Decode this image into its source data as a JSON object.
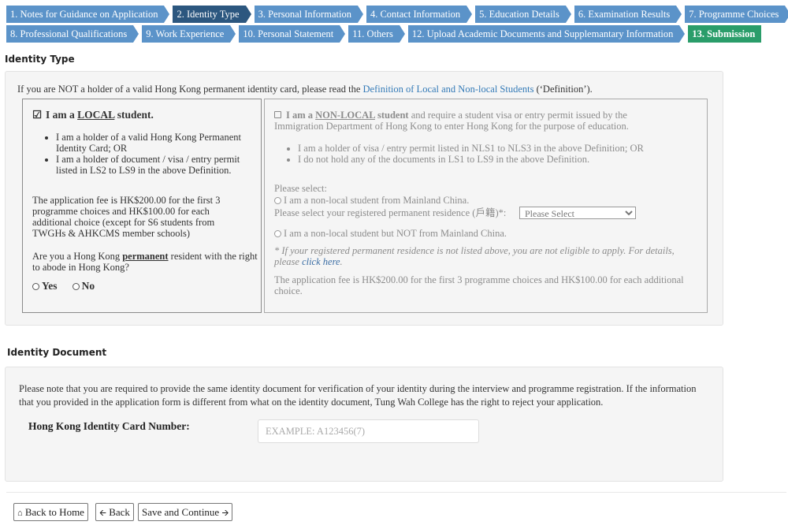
{
  "steps_row1": [
    {
      "label": "1. Notes for Guidance on Application"
    },
    {
      "label": "2. Identity Type"
    },
    {
      "label": "3. Personal Information"
    },
    {
      "label": "4. Contact Information"
    },
    {
      "label": "5. Education Details"
    },
    {
      "label": "6. Examination Results"
    },
    {
      "label": "7. Programme Choices"
    }
  ],
  "steps_row2": [
    {
      "label": "8. Professional Qualifications"
    },
    {
      "label": "9. Work Experience"
    },
    {
      "label": "10. Personal Statement"
    },
    {
      "label": "11. Others"
    },
    {
      "label": "12. Upload Academic Documents and Supplemantary Information"
    },
    {
      "label": "13. Submission"
    }
  ],
  "identity_type": {
    "title": "Identity Type",
    "intro_before": "If you are NOT a holder of a valid Hong Kong permanent identity card, please read the ",
    "intro_link": "Definition of Local and Non-local Students",
    "intro_after": " (‘Definition’).",
    "local": {
      "check_glyph": "☑",
      "title_pre": "I am a ",
      "title_u": "LOCAL",
      "title_post": " student.",
      "bullet1": "I am a holder of a valid Hong Kong Permanent Identity Card; OR",
      "bullet2": "I am a holder of document / visa / entry permit listed in LS2 to LS9 in the above Definition.",
      "fee": "The application fee is HK$200.00 for the first 3 programme choices and HK$100.00 for each additional choice (except for S6 students from TWGHs & AHKCMS member schools)",
      "question_pre": "Are you a Hong Kong ",
      "question_u": "permanent",
      "question_post": " resident with the right to abode in Hong Kong?",
      "yes": "Yes",
      "no": "No"
    },
    "nonlocal": {
      "title_pre": "I am a ",
      "title_u": "NON-LOCAL",
      "title_b": " student",
      "title_rest": " and require a student visa or entry permit issued by the Immigration Department of Hong Kong to enter Hong Kong for the purpose of education.",
      "bullet1": "I am a holder of visa / entry permit listed in NLS1 to NLS3 in the above Definition; OR",
      "bullet2": "I do not hold any of the documents in LS1 to LS9 in the above Definition.",
      "please_select": "Please select:",
      "option_mainland": "I am a non-local student from Mainland China.",
      "residence_label": "Please select your registered permanent residence (戶籍)*:",
      "residence_selected": "Please Select",
      "option_other": "I am a non-local student but NOT from Mainland China.",
      "note_text": "* If your registered permanent residence is not listed above, you are not eligible to apply. For details, please ",
      "note_link": "click here",
      "note_end": ".",
      "fee": "The application fee is HK$200.00 for the first 3 programme choices and HK$100.00 for each additional choice."
    }
  },
  "identity_document": {
    "title": "Identity Document",
    "note": "Please note that you are required to provide the same identity document for verification of your identity during the interview and programme registration. If the information that you provided in the application form is different from what on the identity document, Tung Wah College has the right to reject your application.",
    "hkid_label": "Hong Kong Identity Card Number:",
    "hkid_placeholder": "EXAMPLE: A123456(7)",
    "hkid_value": ""
  },
  "buttons": {
    "home": "Back to Home",
    "home_icon": "home-icon",
    "back": "Back",
    "back_icon": "arrow-left-icon",
    "save": "Save and Continue",
    "save_icon": "arrow-right-icon"
  }
}
